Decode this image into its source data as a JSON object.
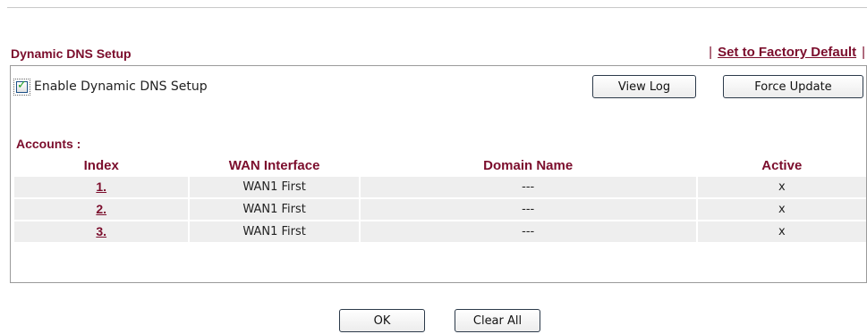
{
  "header": {
    "title": "Dynamic DNS Setup",
    "factory_default": "Set to Factory Default",
    "separator": "|"
  },
  "enable": {
    "label": "Enable Dynamic DNS Setup",
    "checked": true
  },
  "buttons": {
    "view_log": "View Log",
    "force_update": "Force Update",
    "ok": "OK",
    "clear_all": "Clear All"
  },
  "accounts": {
    "label": "Accounts :",
    "columns": [
      "Index",
      "WAN Interface",
      "Domain Name",
      "Active"
    ],
    "rows": [
      {
        "index": "1.",
        "wan": "WAN1 First",
        "domain": "---",
        "active": "x"
      },
      {
        "index": "2.",
        "wan": "WAN1 First",
        "domain": "---",
        "active": "x"
      },
      {
        "index": "3.",
        "wan": "WAN1 First",
        "domain": "---",
        "active": "x"
      }
    ]
  },
  "colors": {
    "accent": "#7b0d2c",
    "row_bg": "#eeeeee",
    "check": "#21a121"
  }
}
